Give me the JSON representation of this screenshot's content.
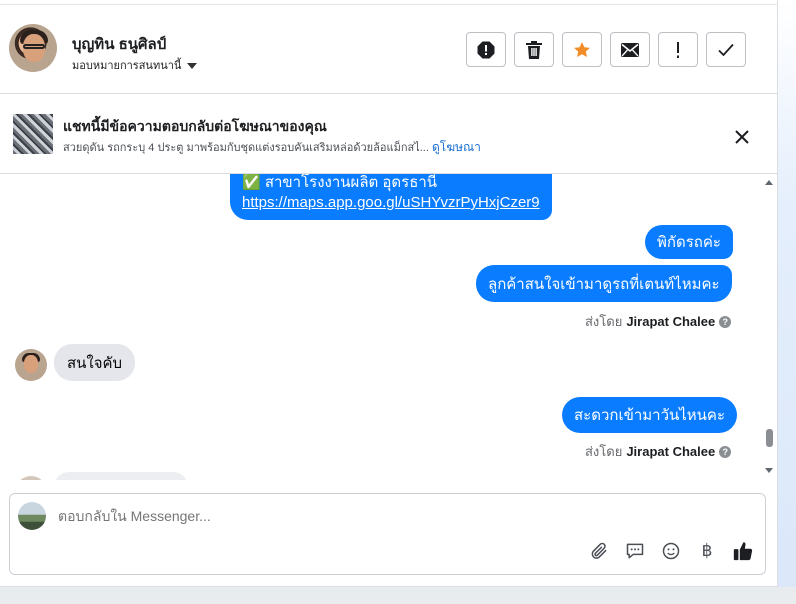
{
  "header": {
    "contact_name": "บุญทิน ธนูศิลป์",
    "assign_label": "มอบหมายการสนทนานี้",
    "actions": [
      {
        "name": "spam-icon",
        "label": "!"
      },
      {
        "name": "trash-icon",
        "label": ""
      },
      {
        "name": "star-icon",
        "label": ""
      },
      {
        "name": "mail-icon",
        "label": ""
      },
      {
        "name": "exclamation-icon",
        "label": "!"
      },
      {
        "name": "check-icon",
        "label": ""
      }
    ]
  },
  "ad_banner": {
    "title": "แชทนี้มีข้อความตอบกลับต่อโฆษณาของคุณ",
    "subtitle": "สวยดุดัน รถกระบุ 4 ประตู มาพร้อมกับชุดแต่งรอบคันเสริมหล่อด้วยล้อแม็กสไ... ",
    "link": "ดูโฆษณา"
  },
  "messages": {
    "m1_line1": "✅ สาขาโรงงานผลิต อุดรธานี",
    "m1_link": "https://maps.app.goo.gl/uSHYvzrPyHxjCzer9",
    "m2": "พิกัดรถค่ะ",
    "m3": "ลูกค้าสนใจเข้ามาดูรถที่เตนท์ไหมคะ",
    "sent_by_prefix": "ส่งโดย",
    "sent_by_name": "Jirapat Chalee",
    "in1": "สนใจคับ",
    "m4": "สะดวกเข้ามาวันไหนคะ"
  },
  "composer": {
    "placeholder": "ตอบกลับใน Messenger...",
    "baht_symbol": "฿"
  },
  "colors": {
    "outgoing_bubble": "#0a7cff",
    "incoming_bubble": "#e4e6eb",
    "star_accent": "#f28c28",
    "link_blue": "#1a6fd4"
  }
}
